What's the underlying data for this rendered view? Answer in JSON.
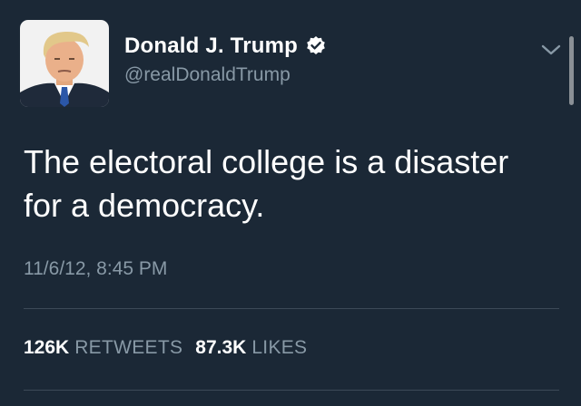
{
  "tweet": {
    "display_name": "Donald J. Trump",
    "handle": "@realDonaldTrump",
    "verified": true,
    "text": "The electoral college is a disaster for a democracy.",
    "timestamp": "11/6/12, 8:45 PM",
    "stats": {
      "retweets_count": "126K",
      "retweets_label": "RETWEETS",
      "likes_count": "87.3K",
      "likes_label": "LIKES"
    },
    "icons": {
      "verified": "verified-badge-icon",
      "menu": "chevron-down-icon",
      "avatar": "profile-photo"
    },
    "colors": {
      "background": "#1b2836",
      "text_primary": "#ffffff",
      "text_secondary": "#8899a6",
      "divider": "#3d4a58"
    }
  }
}
